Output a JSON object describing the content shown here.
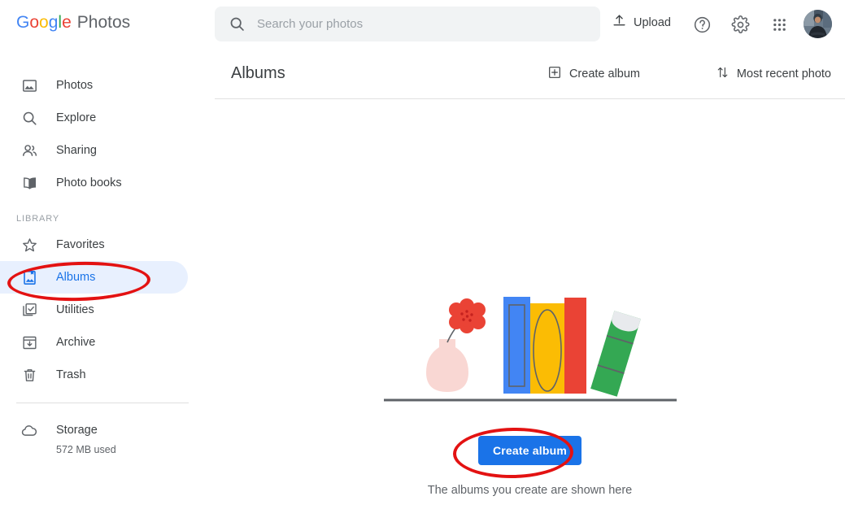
{
  "app": {
    "logo_google": "Google",
    "logo_product": "Photos",
    "logo_letters": [
      {
        "char": "G",
        "color": "#4285F4"
      },
      {
        "char": "o",
        "color": "#EA4335"
      },
      {
        "char": "o",
        "color": "#FBBC05"
      },
      {
        "char": "g",
        "color": "#4285F4"
      },
      {
        "char": "l",
        "color": "#34A853"
      },
      {
        "char": "e",
        "color": "#EA4335"
      }
    ]
  },
  "search": {
    "placeholder": "Search your photos",
    "value": "",
    "icon": "search-icon"
  },
  "header": {
    "upload_label": "Upload",
    "upload_icon": "upload-icon",
    "help_icon": "help-circle-icon",
    "settings_icon": "gear-icon",
    "apps_icon": "apps-grid-icon",
    "avatar": "user-avatar"
  },
  "sidebar": {
    "items": [
      {
        "label": "Photos",
        "icon": "photo-icon",
        "active": false
      },
      {
        "label": "Explore",
        "icon": "search-icon",
        "active": false
      },
      {
        "label": "Sharing",
        "icon": "people-icon",
        "active": false
      },
      {
        "label": "Photo books",
        "icon": "book-icon",
        "active": false
      }
    ],
    "section_label": "LIBRARY",
    "library_items": [
      {
        "label": "Favorites",
        "icon": "star-icon",
        "active": false
      },
      {
        "label": "Albums",
        "icon": "albums-icon",
        "active": true
      },
      {
        "label": "Utilities",
        "icon": "utilities-icon",
        "active": false
      },
      {
        "label": "Archive",
        "icon": "archive-icon",
        "active": false
      },
      {
        "label": "Trash",
        "icon": "trash-icon",
        "active": false
      }
    ],
    "storage": {
      "label": "Storage",
      "used": "572 MB used",
      "icon": "cloud-icon"
    }
  },
  "main": {
    "title": "Albums",
    "create_album_label": "Create album",
    "create_album_icon": "plus-box-icon",
    "sort_label": "Most recent photo",
    "sort_icon": "sort-arrows-icon"
  },
  "empty_state": {
    "button_label": "Create album",
    "caption": "The albums you create are shown here",
    "illustration": "bookshelf-with-vase-illustration"
  },
  "annotations": [
    {
      "name": "highlight-albums-sidebar",
      "shape": "ellipse",
      "color": "#e31212"
    },
    {
      "name": "highlight-create-album-button",
      "shape": "ellipse",
      "color": "#e31212"
    }
  ],
  "colors": {
    "accent": "#1a73e8",
    "active_bg": "#e8f0fe",
    "text_primary": "#3c4043",
    "text_secondary": "#5f6368",
    "annotation": "#e31212",
    "book_blue": "#4285F4",
    "book_yellow": "#FBBC04",
    "book_red": "#EA4335",
    "book_green": "#34A853",
    "vase_pink": "#F8D7D3"
  }
}
